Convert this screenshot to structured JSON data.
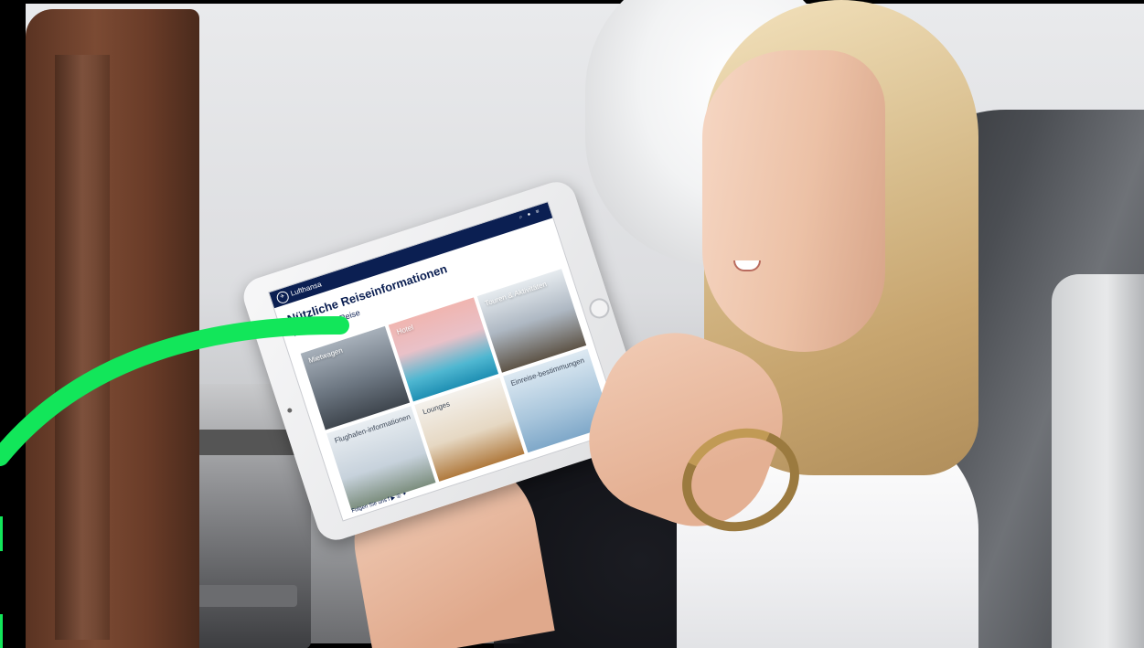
{
  "tablet": {
    "brand": "Lufthansa",
    "page_title": "Nützliche Reiseinformationen",
    "section_title": "Während der Reise",
    "tiles": [
      {
        "label": "Mietwagen"
      },
      {
        "label": "Hotel"
      },
      {
        "label": "Touren & Aktivitäten"
      },
      {
        "label": "Flughafen-informationen"
      },
      {
        "label": "Lounges"
      },
      {
        "label": "Einreise-bestimmungen"
      }
    ],
    "social_label": "Folgen Sie uns"
  },
  "colors": {
    "accent_green": "#12e65a",
    "lufthansa_blue": "#0b1f52",
    "frame_black": "#000000"
  },
  "icons": [
    "lufthansa-logo-icon",
    "search-icon",
    "user-icon",
    "menu-icon",
    "facebook-icon",
    "youtube-icon",
    "instagram-icon",
    "twitter-icon"
  ]
}
